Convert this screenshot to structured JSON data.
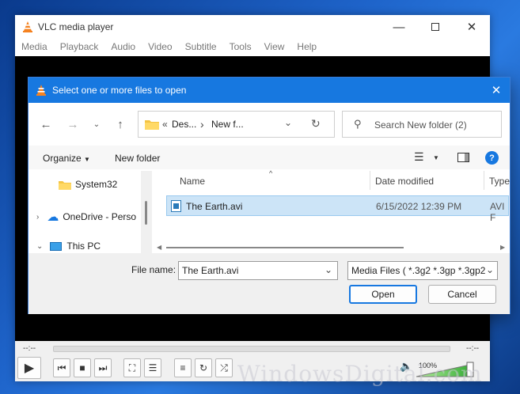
{
  "vlc": {
    "title": "VLC media player",
    "menu": [
      "Media",
      "Playback",
      "Audio",
      "Video",
      "Subtitle",
      "Tools",
      "View",
      "Help"
    ],
    "time_elapsed": "--:--",
    "time_total": "--:--",
    "volume": "100%"
  },
  "dialog": {
    "title": "Select one or more files to open",
    "breadcrumb": [
      "«",
      "Des...",
      "›",
      "New f..."
    ],
    "search_placeholder": "Search New folder (2)",
    "organize": "Organize",
    "new_folder": "New folder",
    "nav": [
      "System32",
      "OneDrive - Perso",
      "This PC"
    ],
    "columns": [
      "Name",
      "Date modified",
      "Type"
    ],
    "file": {
      "name": "The Earth.avi",
      "date": "6/15/2022 12:39 PM",
      "type": "AVI F"
    },
    "file_name_label": "File name:",
    "file_name_value": "The Earth.avi",
    "filter": "Media Files ( *.3g2 *.3gp *.3gp2",
    "open": "Open",
    "cancel": "Cancel"
  },
  "watermark": "WindowsDigital.com",
  "colors": {
    "vlc_orange": "#f58220",
    "dialog_blue": "#1778e0",
    "select_blue": "#cce4f7",
    "help_blue": "#1778e0"
  }
}
